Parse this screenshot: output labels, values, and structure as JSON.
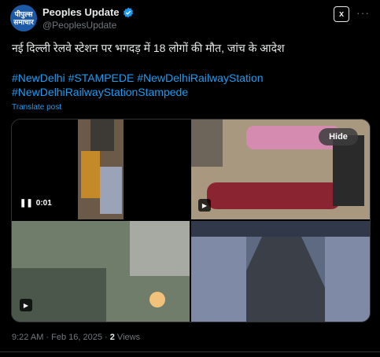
{
  "author": {
    "display_name": "Peoples Update",
    "handle": "@PeoplesUpdate",
    "avatar_text": "पीपुल्स समाचार"
  },
  "header": {
    "grok_label": "x",
    "more_icon": "more-icon"
  },
  "post": {
    "headline": "नई दिल्ली रेलवे स्टेशन पर भगदड़ में 18 लोगों की मौत, जांच के आदेश",
    "hashtags_line1": "#NewDelhi #STAMPEDE #NewDelhiRailwayStation",
    "hashtags_line2": "#NewDelhiRailwayStationStampede",
    "translate_label": "Translate post"
  },
  "media": {
    "video_time": "0:01",
    "hide_label": "Hide"
  },
  "footer": {
    "time": "9:22 AM · Feb 16, 2025 · ",
    "views_count": "2",
    "views_label": " Views"
  },
  "colors": {
    "accent": "#1d9bf0",
    "background": "#000000",
    "text": "#e7e9ea",
    "muted": "#71767b"
  }
}
